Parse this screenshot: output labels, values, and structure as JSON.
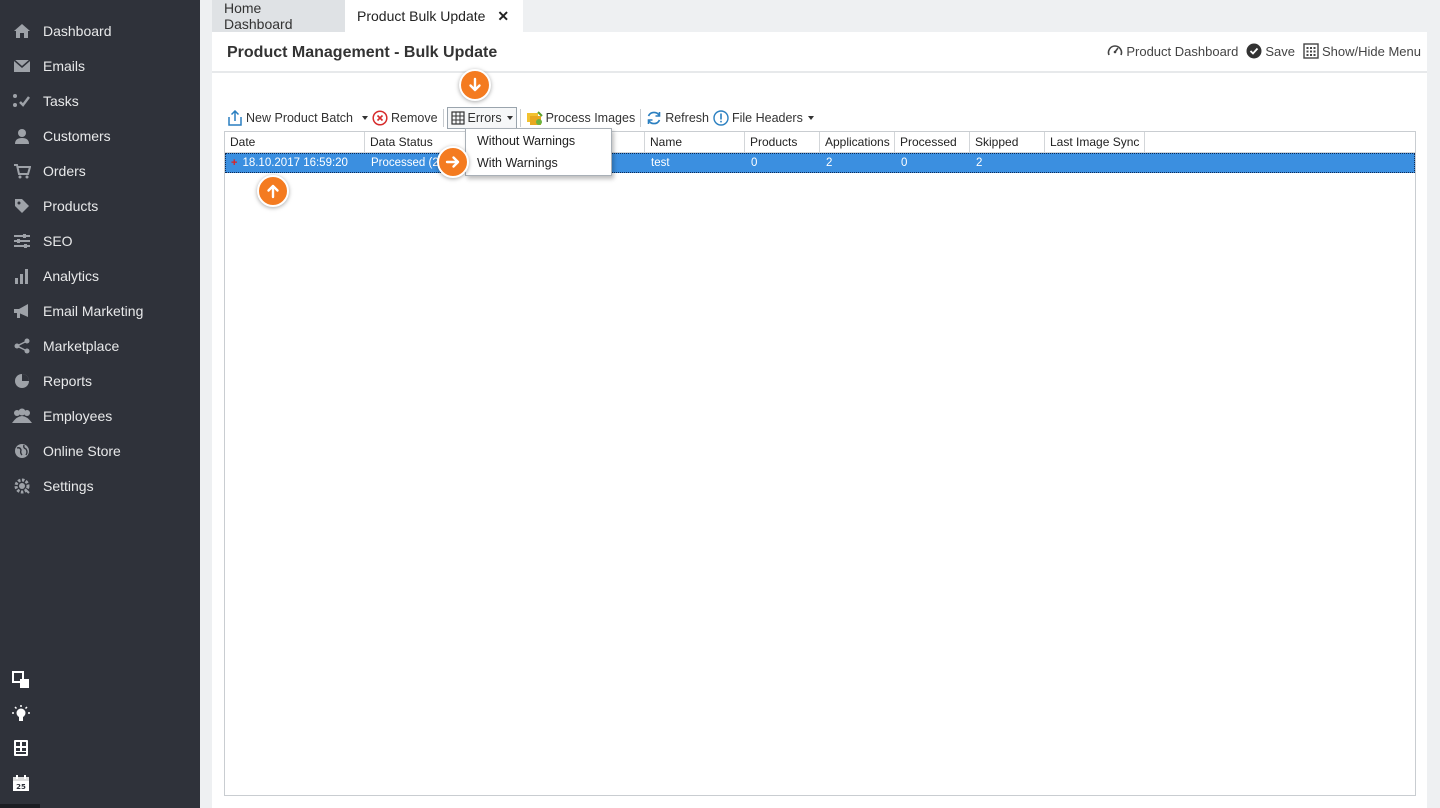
{
  "sidebar": {
    "items": [
      {
        "label": "Dashboard",
        "icon": "home-icon"
      },
      {
        "label": "Emails",
        "icon": "envelope-icon"
      },
      {
        "label": "Tasks",
        "icon": "tasks-icon"
      },
      {
        "label": "Customers",
        "icon": "user-icon"
      },
      {
        "label": "Orders",
        "icon": "cart-icon"
      },
      {
        "label": "Products",
        "icon": "tag-icon"
      },
      {
        "label": "SEO",
        "icon": "sliders-icon"
      },
      {
        "label": "Analytics",
        "icon": "bar-chart-icon"
      },
      {
        "label": "Email Marketing",
        "icon": "megaphone-icon"
      },
      {
        "label": "Marketplace",
        "icon": "share-icon"
      },
      {
        "label": "Reports",
        "icon": "pie-chart-icon"
      },
      {
        "label": "Employees",
        "icon": "users-icon"
      },
      {
        "label": "Online Store",
        "icon": "globe-icon"
      },
      {
        "label": "Settings",
        "icon": "gear-icon"
      }
    ]
  },
  "tabs": {
    "home": "Home Dashboard",
    "active": "Product Bulk Update",
    "close": "✕"
  },
  "header": {
    "title": "Product Management - Bulk Update",
    "actions": {
      "dashboard": "Product Dashboard",
      "save": "Save",
      "menu": "Show/Hide Menu"
    }
  },
  "toolbar": {
    "new_batch": "New Product Batch",
    "remove": "Remove",
    "errors": "Errors",
    "process_images": "Process Images",
    "refresh": "Refresh",
    "file_headers": "File Headers"
  },
  "errors_menu": {
    "items": [
      "Without Warnings",
      "With Warnings"
    ]
  },
  "grid": {
    "columns": [
      "Date",
      "Data Status",
      "Name",
      "Products",
      "Applications",
      "Processed",
      "Skipped",
      "Last Image Sync"
    ],
    "rows": [
      {
        "expand": "+",
        "date": "18.10.2017 16:59:20",
        "status": "Processed (2",
        "name": "test",
        "products": "0",
        "applications": "2",
        "processed": "0",
        "skipped": "2",
        "last_image_sync": ""
      }
    ]
  },
  "colors": {
    "sidebar_bg": "#2f323a",
    "row_selected": "#3b8fe0",
    "callout": "#f47b20"
  }
}
